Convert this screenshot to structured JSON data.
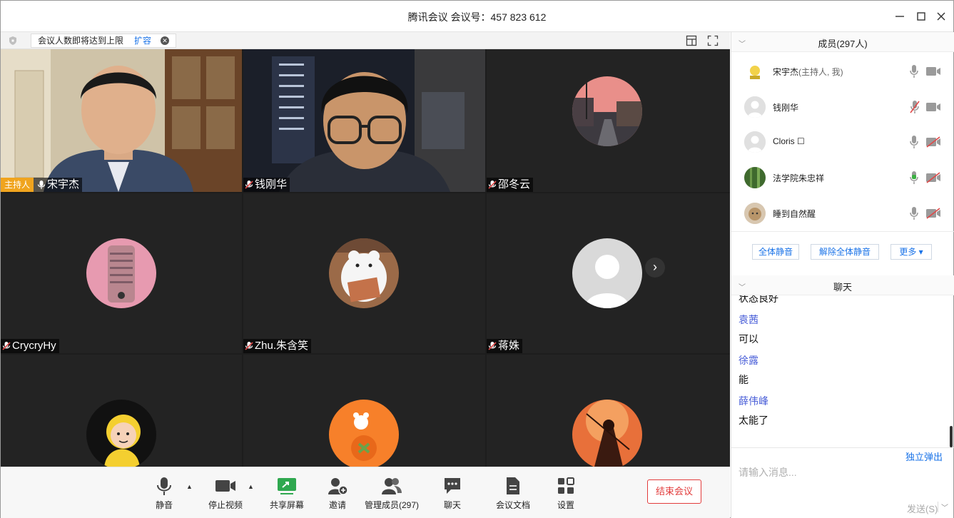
{
  "window": {
    "title": "腾讯会议 会议号：457 823 612"
  },
  "notice": {
    "text": "会议人数即将达到上限",
    "expand_label": "扩容"
  },
  "tiles": [
    {
      "name": "宋宇杰",
      "host_badge": "主持人"
    },
    {
      "name": "钱刚华"
    },
    {
      "name": "邵冬云"
    },
    {
      "name": "CrycryHy"
    },
    {
      "name": "Zhu.朱含笑"
    },
    {
      "name": "蒋姝"
    },
    {
      "name": ""
    },
    {
      "name": ""
    },
    {
      "name": ""
    }
  ],
  "toolbar": {
    "mute": "静音",
    "stop_video": "停止视频",
    "share_screen": "共享屏幕",
    "invite": "邀请",
    "manage_members": "管理成员(297)",
    "chat": "聊天",
    "docs": "会议文档",
    "settings": "设置",
    "end": "结束会议"
  },
  "members_panel": {
    "title": "成员(297人)",
    "members": [
      {
        "name": "宋宇杰",
        "sub": "(主持人, 我)"
      },
      {
        "name": "钱刚华",
        "sub": ""
      },
      {
        "name": "Cloris ☐",
        "sub": ""
      },
      {
        "name": "法学院朱忠祥",
        "sub": ""
      },
      {
        "name": "睡到自然醒",
        "sub": ""
      }
    ],
    "mute_all": "全体静音",
    "unmute_all": "解除全体静音",
    "more": "更多 ▾"
  },
  "chat_panel": {
    "title": "聊天",
    "messages": [
      {
        "text": "状态良好"
      },
      {
        "sender": "袁茜",
        "text": "可以"
      },
      {
        "sender": "徐露",
        "text": "能"
      },
      {
        "sender": "薛伟峰",
        "text": "太能了"
      }
    ],
    "popout": "独立弹出",
    "placeholder": "请输入消息...",
    "send": "发送(S)"
  },
  "colors": {
    "accent": "#1a73e8",
    "danger": "#e23b3b",
    "host_badge": "#f0a41e",
    "sender": "#4a5fd8",
    "mic_active": "#3cb043",
    "muted_red": "#e04848"
  }
}
